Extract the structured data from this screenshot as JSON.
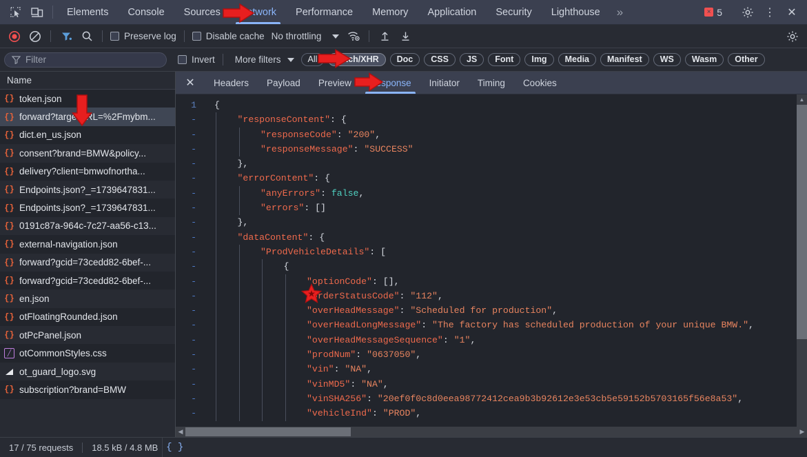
{
  "devtools": {
    "main_tabs": [
      {
        "label": "Elements",
        "active": false
      },
      {
        "label": "Console",
        "active": false
      },
      {
        "label": "Sources",
        "active": false
      },
      {
        "label": "Network",
        "active": true
      },
      {
        "label": "Performance",
        "active": false
      },
      {
        "label": "Memory",
        "active": false
      },
      {
        "label": "Application",
        "active": false
      },
      {
        "label": "Security",
        "active": false
      },
      {
        "label": "Lighthouse",
        "active": false
      }
    ],
    "more_tabs_glyph": "»",
    "inspect_icon": "inspect-cursor-icon",
    "device_icon": "device-toolbar-icon",
    "error_count": "5",
    "error_glyph": "×",
    "settings_glyph": "⚙",
    "kebab_glyph": "⋮",
    "close_glyph": "✕"
  },
  "controlbar": {
    "record_tooltip": "record-button",
    "clear_tooltip": "clear-button",
    "filter_tooltip": "filter-toggle",
    "search_tooltip": "search-button",
    "preserve_log": "Preserve log",
    "disable_cache": "Disable cache",
    "throttling": "No throttling",
    "import_glyph": "⬆",
    "export_glyph": "⬇",
    "settings_glyph": "⚙"
  },
  "filterbar": {
    "filter_placeholder": "Filter",
    "invert": "Invert",
    "more_filters": "More filters",
    "types": [
      {
        "label": "All",
        "active": false
      },
      {
        "label": "Fetch/XHR",
        "active": true
      },
      {
        "label": "Doc",
        "active": false
      },
      {
        "label": "CSS",
        "active": false
      },
      {
        "label": "JS",
        "active": false
      },
      {
        "label": "Font",
        "active": false
      },
      {
        "label": "Img",
        "active": false
      },
      {
        "label": "Media",
        "active": false
      },
      {
        "label": "Manifest",
        "active": false
      },
      {
        "label": "WS",
        "active": false
      },
      {
        "label": "Wasm",
        "active": false
      },
      {
        "label": "Other",
        "active": false
      }
    ]
  },
  "requests": {
    "column_header": "Name",
    "rows": [
      {
        "name": "token.json",
        "icon": "json-icon",
        "selected": false
      },
      {
        "name": "forward?targetURL=%2Fmybm...",
        "icon": "json-icon",
        "selected": true
      },
      {
        "name": "dict.en_us.json",
        "icon": "json-icon",
        "selected": false
      },
      {
        "name": "consent?brand=BMW&policy...",
        "icon": "json-icon",
        "selected": false
      },
      {
        "name": "delivery?client=bmwofnortha...",
        "icon": "json-icon",
        "selected": false
      },
      {
        "name": "Endpoints.json?_=1739647831...",
        "icon": "json-icon",
        "selected": false
      },
      {
        "name": "Endpoints.json?_=1739647831...",
        "icon": "json-icon",
        "selected": false
      },
      {
        "name": "0191c87a-964c-7c27-aa56-c13...",
        "icon": "json-icon",
        "selected": false
      },
      {
        "name": "external-navigation.json",
        "icon": "json-icon",
        "selected": false
      },
      {
        "name": "forward?gcid=73cedd82-6bef-...",
        "icon": "json-icon",
        "selected": false
      },
      {
        "name": "forward?gcid=73cedd82-6bef-...",
        "icon": "json-icon",
        "selected": false
      },
      {
        "name": "en.json",
        "icon": "json-icon",
        "selected": false
      },
      {
        "name": "otFloatingRounded.json",
        "icon": "json-icon",
        "selected": false
      },
      {
        "name": "otPcPanel.json",
        "icon": "json-icon",
        "selected": false
      },
      {
        "name": "otCommonStyles.css",
        "icon": "css-icon",
        "selected": false
      },
      {
        "name": "ot_guard_logo.svg",
        "icon": "svg-icon",
        "selected": false
      },
      {
        "name": "subscription?brand=BMW",
        "icon": "json-icon",
        "selected": false
      }
    ]
  },
  "detail_tabs": [
    {
      "label": "Headers",
      "active": false
    },
    {
      "label": "Payload",
      "active": false
    },
    {
      "label": "Preview",
      "active": false
    },
    {
      "label": "Response",
      "active": true
    },
    {
      "label": "Initiator",
      "active": false
    },
    {
      "label": "Timing",
      "active": false
    },
    {
      "label": "Cookies",
      "active": false
    }
  ],
  "response": {
    "first_line_number": "1",
    "wrapped_marker": "-",
    "lines": [
      {
        "gutter": "1",
        "indent": 0,
        "tokens": [
          {
            "t": "{",
            "c": "p"
          }
        ]
      },
      {
        "gutter": "-",
        "indent": 1,
        "tokens": [
          {
            "t": "\"responseContent\"",
            "c": "k"
          },
          {
            "t": ": {",
            "c": "p"
          }
        ]
      },
      {
        "gutter": "-",
        "indent": 2,
        "tokens": [
          {
            "t": "\"responseCode\"",
            "c": "k"
          },
          {
            "t": ": ",
            "c": "p"
          },
          {
            "t": "\"200\"",
            "c": "s"
          },
          {
            "t": ",",
            "c": "p"
          }
        ]
      },
      {
        "gutter": "-",
        "indent": 2,
        "tokens": [
          {
            "t": "\"responseMessage\"",
            "c": "k"
          },
          {
            "t": ": ",
            "c": "p"
          },
          {
            "t": "\"SUCCESS\"",
            "c": "s"
          }
        ]
      },
      {
        "gutter": "-",
        "indent": 1,
        "tokens": [
          {
            "t": "},",
            "c": "p"
          }
        ]
      },
      {
        "gutter": "-",
        "indent": 1,
        "tokens": [
          {
            "t": "\"errorContent\"",
            "c": "k"
          },
          {
            "t": ": {",
            "c": "p"
          }
        ]
      },
      {
        "gutter": "-",
        "indent": 2,
        "tokens": [
          {
            "t": "\"anyErrors\"",
            "c": "k"
          },
          {
            "t": ": ",
            "c": "p"
          },
          {
            "t": "false",
            "c": "b"
          },
          {
            "t": ",",
            "c": "p"
          }
        ]
      },
      {
        "gutter": "-",
        "indent": 2,
        "tokens": [
          {
            "t": "\"errors\"",
            "c": "k"
          },
          {
            "t": ": []",
            "c": "p"
          }
        ]
      },
      {
        "gutter": "-",
        "indent": 1,
        "tokens": [
          {
            "t": "},",
            "c": "p"
          }
        ]
      },
      {
        "gutter": "-",
        "indent": 1,
        "tokens": [
          {
            "t": "\"dataContent\"",
            "c": "k"
          },
          {
            "t": ": {",
            "c": "p"
          }
        ]
      },
      {
        "gutter": "-",
        "indent": 2,
        "tokens": [
          {
            "t": "\"ProdVehicleDetails\"",
            "c": "k"
          },
          {
            "t": ": [",
            "c": "p"
          }
        ]
      },
      {
        "gutter": "-",
        "indent": 3,
        "tokens": [
          {
            "t": "{",
            "c": "p"
          }
        ]
      },
      {
        "gutter": "-",
        "indent": 4,
        "tokens": [
          {
            "t": "\"optionCode\"",
            "c": "k"
          },
          {
            "t": ": [],",
            "c": "p"
          }
        ]
      },
      {
        "gutter": "-",
        "indent": 4,
        "tokens": [
          {
            "t": "\"orderStatusCode\"",
            "c": "k"
          },
          {
            "t": ": ",
            "c": "p"
          },
          {
            "t": "\"112\"",
            "c": "s"
          },
          {
            "t": ",",
            "c": "p"
          }
        ]
      },
      {
        "gutter": "-",
        "indent": 4,
        "tokens": [
          {
            "t": "\"overHeadMessage\"",
            "c": "k"
          },
          {
            "t": ": ",
            "c": "p"
          },
          {
            "t": "\"Scheduled for production\"",
            "c": "s"
          },
          {
            "t": ",",
            "c": "p"
          }
        ]
      },
      {
        "gutter": "-",
        "indent": 4,
        "tokens": [
          {
            "t": "\"overHeadLongMessage\"",
            "c": "k"
          },
          {
            "t": ": ",
            "c": "p"
          },
          {
            "t": "\"The factory has scheduled production of your unique BMW.\"",
            "c": "s"
          },
          {
            "t": ",",
            "c": "p"
          }
        ]
      },
      {
        "gutter": "-",
        "indent": 4,
        "tokens": [
          {
            "t": "\"overHeadMessageSequence\"",
            "c": "k"
          },
          {
            "t": ": ",
            "c": "p"
          },
          {
            "t": "\"1\"",
            "c": "s"
          },
          {
            "t": ",",
            "c": "p"
          }
        ]
      },
      {
        "gutter": "-",
        "indent": 4,
        "tokens": [
          {
            "t": "\"prodNum\"",
            "c": "k"
          },
          {
            "t": ": ",
            "c": "p"
          },
          {
            "t": "\"0637050\"",
            "c": "s"
          },
          {
            "t": ",",
            "c": "p"
          }
        ]
      },
      {
        "gutter": "-",
        "indent": 4,
        "tokens": [
          {
            "t": "\"vin\"",
            "c": "k"
          },
          {
            "t": ": ",
            "c": "p"
          },
          {
            "t": "\"NA\"",
            "c": "s"
          },
          {
            "t": ",",
            "c": "p"
          }
        ]
      },
      {
        "gutter": "-",
        "indent": 4,
        "tokens": [
          {
            "t": "\"vinMD5\"",
            "c": "k"
          },
          {
            "t": ": ",
            "c": "p"
          },
          {
            "t": "\"NA\"",
            "c": "s"
          },
          {
            "t": ",",
            "c": "p"
          }
        ]
      },
      {
        "gutter": "-",
        "indent": 4,
        "tokens": [
          {
            "t": "\"vinSHA256\"",
            "c": "k"
          },
          {
            "t": ": ",
            "c": "p"
          },
          {
            "t": "\"20ef0f0c8d0eea98772412cea9b3b92612e3e53cb5e59152b5703165f56e8a53\"",
            "c": "s"
          },
          {
            "t": ",",
            "c": "p"
          }
        ]
      },
      {
        "gutter": "-",
        "indent": 4,
        "tokens": [
          {
            "t": "\"vehicleInd\"",
            "c": "k"
          },
          {
            "t": ": ",
            "c": "p"
          },
          {
            "t": "\"PROD\"",
            "c": "s"
          },
          {
            "t": ",",
            "c": "p"
          }
        ]
      }
    ]
  },
  "statusbar": {
    "requests": "17 / 75 requests",
    "transferred": "18.5 kB / 4.8 MB",
    "pretty_print": "{ }"
  },
  "annotations": {
    "arrow_glyph": "⬇",
    "star_glyph": "★",
    "color": "#e81f1f",
    "markers": [
      {
        "name": "network-tab-arrow",
        "kind": "arrow-right"
      },
      {
        "name": "fetch-xhr-chip-arrow",
        "kind": "arrow-right"
      },
      {
        "name": "response-tab-arrow",
        "kind": "arrow-right"
      },
      {
        "name": "token-json-arrow",
        "kind": "arrow-down"
      },
      {
        "name": "order-status-code-star",
        "kind": "star"
      }
    ]
  }
}
